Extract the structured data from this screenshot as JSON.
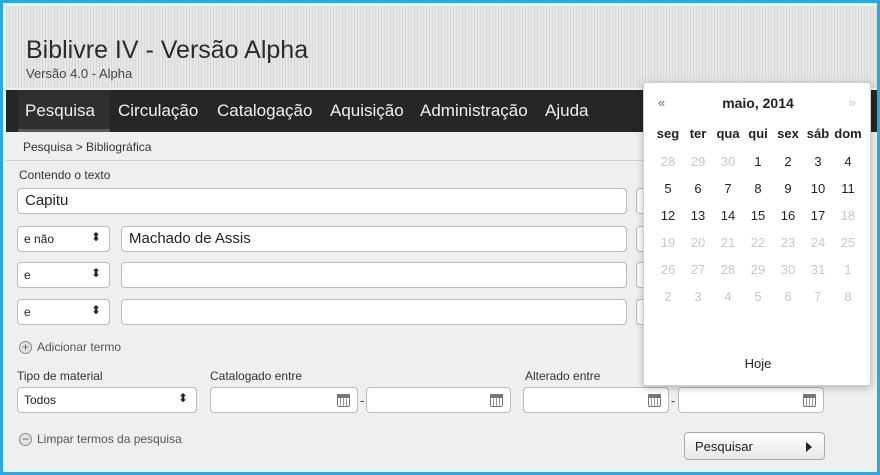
{
  "header": {
    "title": "Biblivre IV - Versão Alpha",
    "subtitle": "Versão 4.0 - Alpha"
  },
  "nav": {
    "items": [
      {
        "label": "Pesquisa"
      },
      {
        "label": "Circulação"
      },
      {
        "label": "Catalogação"
      },
      {
        "label": "Aquisição"
      },
      {
        "label": "Administração"
      },
      {
        "label": "Ajuda"
      }
    ],
    "active": "Pesquisa"
  },
  "breadcrumb": "Pesquisa > Bibliográfica",
  "search": {
    "contains_label": "Contendo o texto",
    "contains_value": "Capitu",
    "terms": [
      {
        "operator": "e não",
        "value": "Machado de Assis"
      },
      {
        "operator": "e",
        "value": ""
      },
      {
        "operator": "e",
        "value": ""
      }
    ],
    "add_term_label": "Adicionar termo",
    "material_label": "Tipo de material",
    "material_value": "Todos",
    "cataloged_label": "Catalogado entre",
    "altered_label": "Alterado entre",
    "clear_label": "Limpar termos da pesquisa",
    "search_button": "Pesquisar"
  },
  "datepicker": {
    "prev": "«",
    "next": "»",
    "month_title": "maio, 2014",
    "weekdays": [
      "seg",
      "ter",
      "qua",
      "qui",
      "sex",
      "sáb",
      "dom"
    ],
    "weeks": [
      [
        {
          "d": "28",
          "m": true
        },
        {
          "d": "29",
          "m": true
        },
        {
          "d": "30",
          "m": true
        },
        {
          "d": "1",
          "m": false
        },
        {
          "d": "2",
          "m": false
        },
        {
          "d": "3",
          "m": false
        },
        {
          "d": "4",
          "m": false
        }
      ],
      [
        {
          "d": "5",
          "m": false
        },
        {
          "d": "6",
          "m": false
        },
        {
          "d": "7",
          "m": false
        },
        {
          "d": "8",
          "m": false
        },
        {
          "d": "9",
          "m": false
        },
        {
          "d": "10",
          "m": false
        },
        {
          "d": "11",
          "m": false
        }
      ],
      [
        {
          "d": "12",
          "m": false
        },
        {
          "d": "13",
          "m": false
        },
        {
          "d": "14",
          "m": false
        },
        {
          "d": "15",
          "m": false
        },
        {
          "d": "16",
          "m": false
        },
        {
          "d": "17",
          "m": false
        },
        {
          "d": "18",
          "m": true
        }
      ],
      [
        {
          "d": "19",
          "m": true
        },
        {
          "d": "20",
          "m": true
        },
        {
          "d": "21",
          "m": true
        },
        {
          "d": "22",
          "m": true
        },
        {
          "d": "23",
          "m": true
        },
        {
          "d": "24",
          "m": true
        },
        {
          "d": "25",
          "m": true
        }
      ],
      [
        {
          "d": "26",
          "m": true
        },
        {
          "d": "27",
          "m": true
        },
        {
          "d": "28",
          "m": true
        },
        {
          "d": "29",
          "m": true
        },
        {
          "d": "30",
          "m": true
        },
        {
          "d": "31",
          "m": true
        },
        {
          "d": "1",
          "m": true
        }
      ],
      [
        {
          "d": "2",
          "m": true
        },
        {
          "d": "3",
          "m": true
        },
        {
          "d": "4",
          "m": true
        },
        {
          "d": "5",
          "m": true
        },
        {
          "d": "6",
          "m": true
        },
        {
          "d": "7",
          "m": true
        },
        {
          "d": "8",
          "m": true
        }
      ]
    ],
    "today_label": "Hoje"
  },
  "colors": {
    "frame_border": "#2aa8e0",
    "nav_background": "#262626"
  }
}
